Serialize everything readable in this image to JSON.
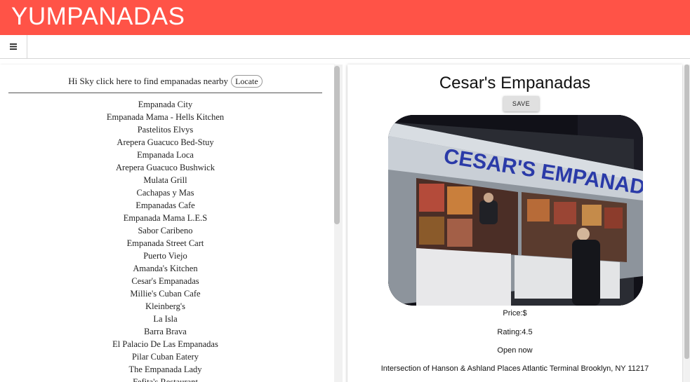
{
  "app": {
    "title": "YUMPANADAS"
  },
  "toolbar": {
    "menu_icon": "hamburger-icon"
  },
  "locator": {
    "greeting": "Hi Sky click here to find empanadas nearby",
    "button_label": "Locate"
  },
  "places": [
    "Empanada City",
    "Empanada Mama - Hells Kitchen",
    "Pastelitos Elvys",
    "Arepera Guacuco Bed-Stuy",
    "Empanada Loca",
    "Arepera Guacuco Bushwick",
    "Mulata Grill",
    "Cachapas y Mas",
    "Empanadas Cafe",
    "Empanada Mama L.E.S",
    "Sabor Caribeno",
    "Empanada Street Cart",
    "Puerto Viejo",
    "Amanda's Kitchen",
    "Cesar's Empanadas",
    "Millie's Cuban Cafe",
    "Kleinberg's",
    "La Isla",
    "Barra Brava",
    "El Palacio De Las Empanadas",
    "Pilar Cuban Eatery",
    "The Empanada Lady",
    "Fefita's Restaurant"
  ],
  "detail": {
    "name": "Cesar's Empanadas",
    "save_label": "SAVE",
    "photo_sign_text": "CESAR'S EMPANADAS",
    "price": "Price:$",
    "rating": "Rating:4.5",
    "status": "Open now",
    "address": "Intersection of Hanson & Ashland Places Atlantic Terminal Brooklyn, NY 11217"
  },
  "colors": {
    "appbar": "#ff5347",
    "sign_text": "#2a3aa8"
  }
}
